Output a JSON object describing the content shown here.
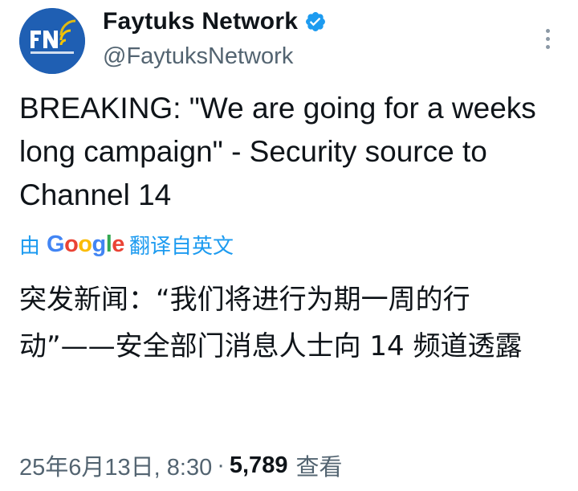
{
  "author": {
    "display_name": "Faytuks Network",
    "handle": "@FaytuksNetwork",
    "verified": true,
    "avatar_icon": "faytuks-network-logo",
    "avatar_bg": "#1f5fb3"
  },
  "tweet": {
    "text": "BREAKING: \"We are going for a weeks long campaign\" - Security source to Channel 14",
    "translation_by_prefix": "由",
    "translation_by_suffix": "翻译自英文",
    "translated_text": "突发新闻：“我们将进行为期一周的行动”——安全部门消息人士向 14 频道透露",
    "timestamp": "25年6月13日, 8:30",
    "separator": "·",
    "views_count": "5,789",
    "views_label": "查看"
  },
  "colors": {
    "accent": "#1d9bf0",
    "secondary_text": "#536471",
    "primary_text": "#0f1419"
  },
  "icons": {
    "verified": "verified-badge-icon",
    "more": "more-options-icon"
  }
}
